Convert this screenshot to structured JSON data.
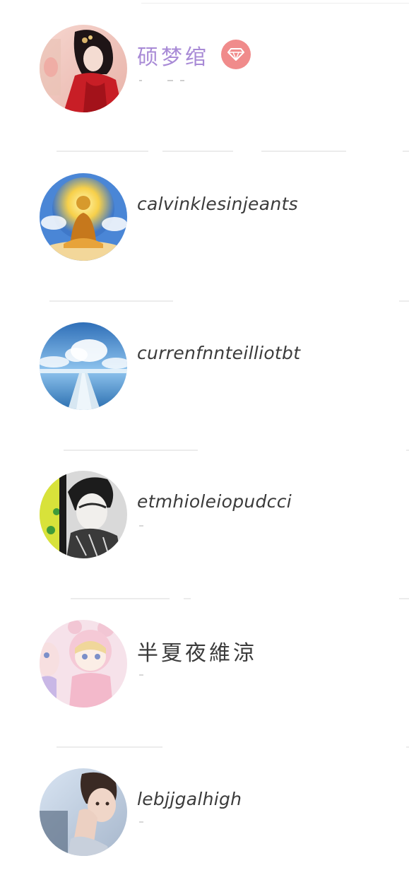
{
  "users": [
    {
      "name": "硕梦绾",
      "is_vip": true,
      "vip_icon": "diamond-icon",
      "vip_color": "#f08b8b",
      "name_color": "#a88ad6"
    },
    {
      "name": "calvinklesinjeants",
      "is_vip": false
    },
    {
      "name": "currenfnnteilliotbt",
      "is_vip": false
    },
    {
      "name": "etmhioleiopudcci",
      "is_vip": false
    },
    {
      "name": "半夏夜維涼",
      "is_vip": false
    },
    {
      "name": "lebjjgalhigh",
      "is_vip": false
    }
  ]
}
